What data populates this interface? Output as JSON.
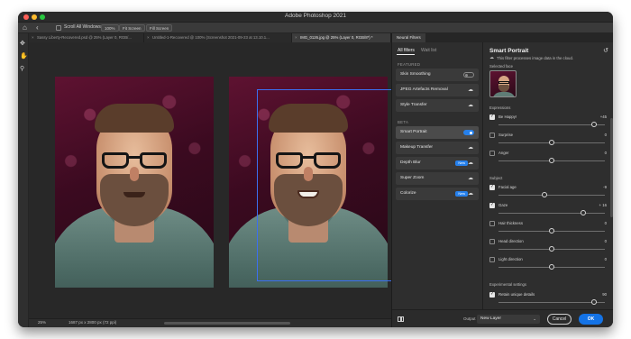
{
  "app": {
    "title": "Adobe Photoshop 2021"
  },
  "options_bar": {
    "scroll_all_label": "Scroll All Windows",
    "zoom_button": "100%",
    "fit_button": "Fit Screen",
    "fill_button": "Fill Screen"
  },
  "doc_tabs": [
    {
      "label": "Sassy Liberty-Recovered.psd @ 25% (Layer 0, RGB/..."
    },
    {
      "label": "Untitled-1-Recovered @ 100% (Screenshot 2021-09-23 at 13.10.1..."
    },
    {
      "label": "IMG_0126.jpg @ 25% (Layer 0, RGB/8*) *"
    }
  ],
  "status": {
    "zoom": "25%",
    "info": "1687 px x 2800 px (72 ppi)"
  },
  "neural_filters": {
    "panel_tab": "Neural Filters",
    "tabs": {
      "all": "All filters",
      "waitlist": "Wait list"
    },
    "featured_label": "FEATURED",
    "beta_label": "BETA",
    "featured": [
      {
        "name": "Skin Smoothing"
      },
      {
        "name": "JPEG Artefacts Removal"
      },
      {
        "name": "Style Transfer"
      }
    ],
    "beta": [
      {
        "name": "Smart Portrait"
      },
      {
        "name": "Makeup Transfer"
      },
      {
        "name": "Depth Blur",
        "badge": "New"
      },
      {
        "name": "Super Zoom"
      },
      {
        "name": "Colorize",
        "badge": "New"
      }
    ]
  },
  "smart_portrait": {
    "title": "Smart Portrait",
    "description": "This filter processes image data in the cloud.",
    "selected_face_label": "Selected face",
    "expressions_label": "Expressions",
    "subject_label": "Subject",
    "experimental_label": "Experimental settings",
    "params": [
      {
        "name": "Be Happy!",
        "value": "+45",
        "checked": true,
        "level": 0.9
      },
      {
        "name": "Surprise",
        "value": "0",
        "checked": false,
        "level": 0.5
      },
      {
        "name": "Anger",
        "value": "0",
        "checked": false,
        "level": 0.5
      },
      {
        "name": "Facial age",
        "value": "-9",
        "checked": true,
        "level": 0.43
      },
      {
        "name": "Gaze",
        "value": "+ 16",
        "checked": true,
        "level": 0.8
      },
      {
        "name": "Hair thickness",
        "value": "0",
        "checked": false,
        "level": 0.5
      },
      {
        "name": "Head direction",
        "value": "0",
        "checked": false,
        "level": 0.5
      },
      {
        "name": "Light direction",
        "value": "0",
        "checked": false,
        "level": 0.5
      },
      {
        "name": "Retain unique details",
        "value": "90",
        "checked": true,
        "level": 0.9
      }
    ]
  },
  "footer": {
    "output_label": "Output",
    "output_value": "New Layer",
    "cancel": "Cancel",
    "ok": "OK"
  }
}
